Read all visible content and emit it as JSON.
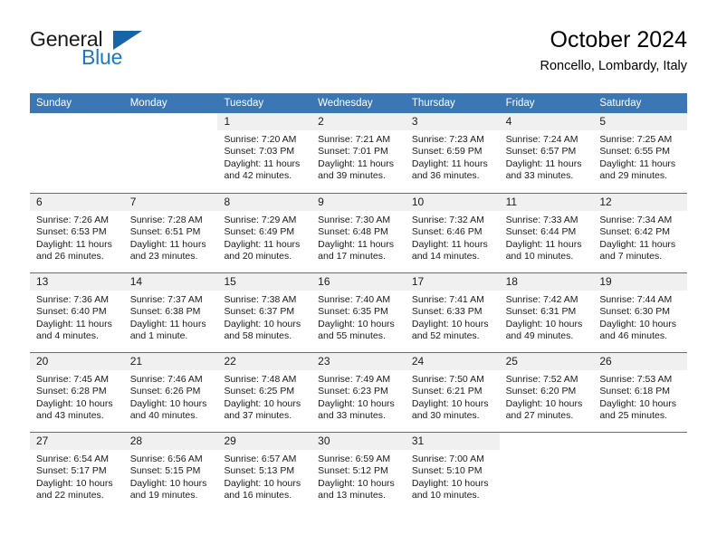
{
  "brand": {
    "word_one": "General",
    "word_two": "Blue",
    "logo_icon": "triangle-logo-icon",
    "accent_color": "#1f77c4",
    "triangle_color": "#1565a8"
  },
  "header": {
    "title": "October 2024",
    "subtitle": "Roncello, Lombardy, Italy"
  },
  "colors": {
    "header_row": "#3b77b5",
    "day_number_band": "#f0f0f0",
    "text": "#1a1a1a"
  },
  "weekdays": [
    "Sunday",
    "Monday",
    "Tuesday",
    "Wednesday",
    "Thursday",
    "Friday",
    "Saturday"
  ],
  "weeks": [
    [
      {
        "day": "",
        "blank": true,
        "sunrise": "",
        "sunset": "",
        "daylight_line1": "",
        "daylight_line2": ""
      },
      {
        "day": "",
        "blank": true,
        "sunrise": "",
        "sunset": "",
        "daylight_line1": "",
        "daylight_line2": ""
      },
      {
        "day": "1",
        "sunrise": "Sunrise: 7:20 AM",
        "sunset": "Sunset: 7:03 PM",
        "daylight_line1": "Daylight: 11 hours",
        "daylight_line2": "and 42 minutes."
      },
      {
        "day": "2",
        "sunrise": "Sunrise: 7:21 AM",
        "sunset": "Sunset: 7:01 PM",
        "daylight_line1": "Daylight: 11 hours",
        "daylight_line2": "and 39 minutes."
      },
      {
        "day": "3",
        "sunrise": "Sunrise: 7:23 AM",
        "sunset": "Sunset: 6:59 PM",
        "daylight_line1": "Daylight: 11 hours",
        "daylight_line2": "and 36 minutes."
      },
      {
        "day": "4",
        "sunrise": "Sunrise: 7:24 AM",
        "sunset": "Sunset: 6:57 PM",
        "daylight_line1": "Daylight: 11 hours",
        "daylight_line2": "and 33 minutes."
      },
      {
        "day": "5",
        "sunrise": "Sunrise: 7:25 AM",
        "sunset": "Sunset: 6:55 PM",
        "daylight_line1": "Daylight: 11 hours",
        "daylight_line2": "and 29 minutes."
      }
    ],
    [
      {
        "day": "6",
        "sunrise": "Sunrise: 7:26 AM",
        "sunset": "Sunset: 6:53 PM",
        "daylight_line1": "Daylight: 11 hours",
        "daylight_line2": "and 26 minutes."
      },
      {
        "day": "7",
        "sunrise": "Sunrise: 7:28 AM",
        "sunset": "Sunset: 6:51 PM",
        "daylight_line1": "Daylight: 11 hours",
        "daylight_line2": "and 23 minutes."
      },
      {
        "day": "8",
        "sunrise": "Sunrise: 7:29 AM",
        "sunset": "Sunset: 6:49 PM",
        "daylight_line1": "Daylight: 11 hours",
        "daylight_line2": "and 20 minutes."
      },
      {
        "day": "9",
        "sunrise": "Sunrise: 7:30 AM",
        "sunset": "Sunset: 6:48 PM",
        "daylight_line1": "Daylight: 11 hours",
        "daylight_line2": "and 17 minutes."
      },
      {
        "day": "10",
        "sunrise": "Sunrise: 7:32 AM",
        "sunset": "Sunset: 6:46 PM",
        "daylight_line1": "Daylight: 11 hours",
        "daylight_line2": "and 14 minutes."
      },
      {
        "day": "11",
        "sunrise": "Sunrise: 7:33 AM",
        "sunset": "Sunset: 6:44 PM",
        "daylight_line1": "Daylight: 11 hours",
        "daylight_line2": "and 10 minutes."
      },
      {
        "day": "12",
        "sunrise": "Sunrise: 7:34 AM",
        "sunset": "Sunset: 6:42 PM",
        "daylight_line1": "Daylight: 11 hours",
        "daylight_line2": "and 7 minutes."
      }
    ],
    [
      {
        "day": "13",
        "sunrise": "Sunrise: 7:36 AM",
        "sunset": "Sunset: 6:40 PM",
        "daylight_line1": "Daylight: 11 hours",
        "daylight_line2": "and 4 minutes."
      },
      {
        "day": "14",
        "sunrise": "Sunrise: 7:37 AM",
        "sunset": "Sunset: 6:38 PM",
        "daylight_line1": "Daylight: 11 hours",
        "daylight_line2": "and 1 minute."
      },
      {
        "day": "15",
        "sunrise": "Sunrise: 7:38 AM",
        "sunset": "Sunset: 6:37 PM",
        "daylight_line1": "Daylight: 10 hours",
        "daylight_line2": "and 58 minutes."
      },
      {
        "day": "16",
        "sunrise": "Sunrise: 7:40 AM",
        "sunset": "Sunset: 6:35 PM",
        "daylight_line1": "Daylight: 10 hours",
        "daylight_line2": "and 55 minutes."
      },
      {
        "day": "17",
        "sunrise": "Sunrise: 7:41 AM",
        "sunset": "Sunset: 6:33 PM",
        "daylight_line1": "Daylight: 10 hours",
        "daylight_line2": "and 52 minutes."
      },
      {
        "day": "18",
        "sunrise": "Sunrise: 7:42 AM",
        "sunset": "Sunset: 6:31 PM",
        "daylight_line1": "Daylight: 10 hours",
        "daylight_line2": "and 49 minutes."
      },
      {
        "day": "19",
        "sunrise": "Sunrise: 7:44 AM",
        "sunset": "Sunset: 6:30 PM",
        "daylight_line1": "Daylight: 10 hours",
        "daylight_line2": "and 46 minutes."
      }
    ],
    [
      {
        "day": "20",
        "sunrise": "Sunrise: 7:45 AM",
        "sunset": "Sunset: 6:28 PM",
        "daylight_line1": "Daylight: 10 hours",
        "daylight_line2": "and 43 minutes."
      },
      {
        "day": "21",
        "sunrise": "Sunrise: 7:46 AM",
        "sunset": "Sunset: 6:26 PM",
        "daylight_line1": "Daylight: 10 hours",
        "daylight_line2": "and 40 minutes."
      },
      {
        "day": "22",
        "sunrise": "Sunrise: 7:48 AM",
        "sunset": "Sunset: 6:25 PM",
        "daylight_line1": "Daylight: 10 hours",
        "daylight_line2": "and 37 minutes."
      },
      {
        "day": "23",
        "sunrise": "Sunrise: 7:49 AM",
        "sunset": "Sunset: 6:23 PM",
        "daylight_line1": "Daylight: 10 hours",
        "daylight_line2": "and 33 minutes."
      },
      {
        "day": "24",
        "sunrise": "Sunrise: 7:50 AM",
        "sunset": "Sunset: 6:21 PM",
        "daylight_line1": "Daylight: 10 hours",
        "daylight_line2": "and 30 minutes."
      },
      {
        "day": "25",
        "sunrise": "Sunrise: 7:52 AM",
        "sunset": "Sunset: 6:20 PM",
        "daylight_line1": "Daylight: 10 hours",
        "daylight_line2": "and 27 minutes."
      },
      {
        "day": "26",
        "sunrise": "Sunrise: 7:53 AM",
        "sunset": "Sunset: 6:18 PM",
        "daylight_line1": "Daylight: 10 hours",
        "daylight_line2": "and 25 minutes."
      }
    ],
    [
      {
        "day": "27",
        "sunrise": "Sunrise: 6:54 AM",
        "sunset": "Sunset: 5:17 PM",
        "daylight_line1": "Daylight: 10 hours",
        "daylight_line2": "and 22 minutes."
      },
      {
        "day": "28",
        "sunrise": "Sunrise: 6:56 AM",
        "sunset": "Sunset: 5:15 PM",
        "daylight_line1": "Daylight: 10 hours",
        "daylight_line2": "and 19 minutes."
      },
      {
        "day": "29",
        "sunrise": "Sunrise: 6:57 AM",
        "sunset": "Sunset: 5:13 PM",
        "daylight_line1": "Daylight: 10 hours",
        "daylight_line2": "and 16 minutes."
      },
      {
        "day": "30",
        "sunrise": "Sunrise: 6:59 AM",
        "sunset": "Sunset: 5:12 PM",
        "daylight_line1": "Daylight: 10 hours",
        "daylight_line2": "and 13 minutes."
      },
      {
        "day": "31",
        "sunrise": "Sunrise: 7:00 AM",
        "sunset": "Sunset: 5:10 PM",
        "daylight_line1": "Daylight: 10 hours",
        "daylight_line2": "and 10 minutes."
      },
      {
        "day": "",
        "blank": true,
        "sunrise": "",
        "sunset": "",
        "daylight_line1": "",
        "daylight_line2": ""
      },
      {
        "day": "",
        "blank": true,
        "sunrise": "",
        "sunset": "",
        "daylight_line1": "",
        "daylight_line2": ""
      }
    ]
  ]
}
